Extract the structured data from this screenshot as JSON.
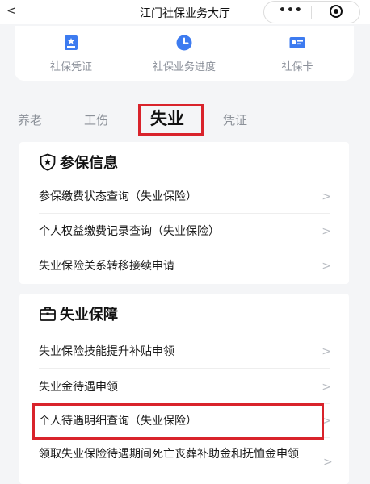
{
  "header": {
    "back_glyph": "<",
    "title": "江门社保业务大厅",
    "more_glyph": "•••"
  },
  "quick_links": [
    {
      "label": "社保凭证",
      "icon": "certificate-icon"
    },
    {
      "label": "社保业务进度",
      "icon": "clock-icon"
    },
    {
      "label": "社保卡",
      "icon": "card-icon"
    }
  ],
  "tabs": [
    {
      "label": "养老",
      "active": false
    },
    {
      "label": "工伤",
      "active": false
    },
    {
      "label": "失业",
      "active": true
    },
    {
      "label": "凭证",
      "active": false
    }
  ],
  "sections": [
    {
      "title": "参保信息",
      "icon": "shield-star-icon",
      "items": [
        {
          "label": "参保缴费状态查询（失业保险）"
        },
        {
          "label": "个人权益缴费记录查询（失业保险）"
        },
        {
          "label": "失业保险关系转移接续申请"
        }
      ]
    },
    {
      "title": "失业保障",
      "icon": "briefcase-icon",
      "items": [
        {
          "label": "失业保险技能提升补贴申领"
        },
        {
          "label": "失业金待遇申领"
        },
        {
          "label": "个人待遇明细查询（失业保险）",
          "highlighted": true
        },
        {
          "label": "领取失业保险待遇期间死亡丧葬补助金和抚恤金申领"
        }
      ]
    }
  ],
  "chevron_glyph": ">",
  "colors": {
    "accent_blue": "#3d7bf0",
    "highlight_red": "#d9232b",
    "background": "#f4f5f7"
  }
}
